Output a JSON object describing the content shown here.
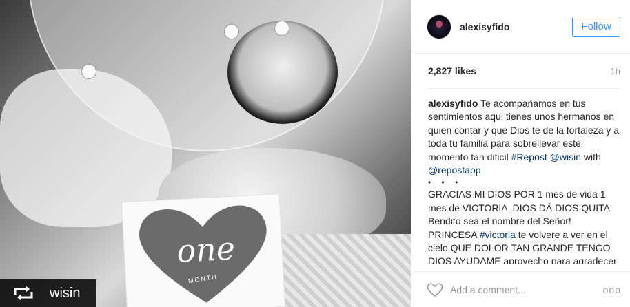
{
  "photo": {
    "alt": "post photo",
    "card_word": "one",
    "card_subword": "MONTH",
    "repost": {
      "username": "wisin"
    }
  },
  "post": {
    "username": "alexisyfido",
    "follow_label": "Follow",
    "likes": "2,827 likes",
    "time": "1h",
    "caption": {
      "username": "alexisyfido",
      "text1": "Te acompañamos en tus sentimientos aqui tienes unos hermanos en quien contar y que Dios te de la fortaleza y a toda tu familia para sobrellevar este momento tan dificil",
      "tag_repost": "#Repost",
      "mention_wisin": "@wisin",
      "with": "with",
      "mention_repostapp": "@repostapp",
      "dots": "• • •",
      "text2": "GRACIAS MI DIOS POR 1 mes de vida 1 mes de VICTORIA .DIOS DÁ DIOS QUITA Bendito sea el nombre del Señor! PRINCESA",
      "tag_victoria": "#victoria",
      "text3": "te volvere a ver en el cielo QUE DOLOR TAN GRANDE TENGO DIOS AYUDAME aprovecho para agradecer a millones de personas que"
    },
    "comment_placeholder": "Add a comment...",
    "more_label": "ooo"
  },
  "colors": {
    "accent": "#3897f0",
    "hashtag": "#003569",
    "muted": "#999999"
  },
  "icons": [
    "repost-icon",
    "heart-icon",
    "more-options-icon"
  ]
}
